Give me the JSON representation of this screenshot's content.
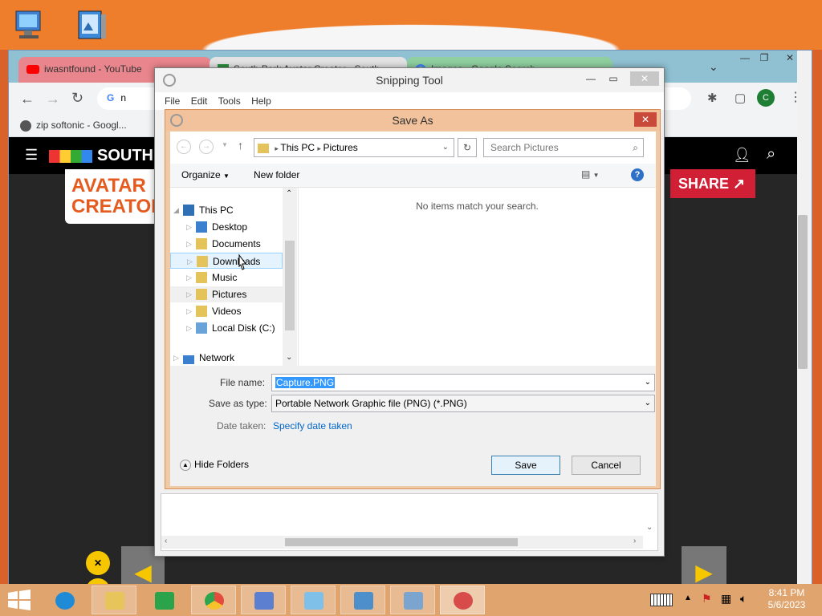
{
  "desktop": {
    "icons": [
      {
        "name": "computer-icon"
      },
      {
        "name": "picture-app-icon"
      }
    ]
  },
  "chrome": {
    "tabs": [
      {
        "label": "iwasntfound - YouTube"
      },
      {
        "label": "South Park Avatar Creator - South"
      },
      {
        "label": "Images - Google Search"
      }
    ],
    "address_text": "n",
    "bookmark": "zip softonic - Googl...",
    "profile_initial": "C",
    "page": {
      "logo_text": "SOUTH",
      "banner_line1": "AVATAR",
      "banner_line2": "CREATOR",
      "share_label": "SHARE"
    }
  },
  "snipping_tool": {
    "title": "Snipping Tool",
    "menu": [
      "File",
      "Edit",
      "Tools",
      "Help"
    ]
  },
  "save_as": {
    "title": "Save As",
    "path": [
      "This PC",
      "Pictures"
    ],
    "search_placeholder": "Search Pictures",
    "organize_label": "Organize",
    "new_folder_label": "New folder",
    "nav_tree": [
      {
        "label": "This PC",
        "level": 0
      },
      {
        "label": "Desktop",
        "level": 1
      },
      {
        "label": "Documents",
        "level": 1
      },
      {
        "label": "Downloads",
        "level": 1
      },
      {
        "label": "Music",
        "level": 1
      },
      {
        "label": "Pictures",
        "level": 1
      },
      {
        "label": "Videos",
        "level": 1
      },
      {
        "label": "Local Disk (C:)",
        "level": 1
      },
      {
        "label": "Network",
        "level": 0
      }
    ],
    "empty_message": "No items match your search.",
    "file_name_label": "File name:",
    "file_name_value": "Capture.PNG",
    "save_type_label": "Save as type:",
    "save_type_value": "Portable Network Graphic file (PNG) (*.PNG)",
    "date_taken_label": "Date taken:",
    "date_taken_link": "Specify date taken",
    "hide_folders_label": "Hide Folders",
    "save_button": "Save",
    "cancel_button": "Cancel"
  },
  "taskbar": {
    "apps": [
      {
        "name": "internet-explorer-icon",
        "color": "#1f8ad6"
      },
      {
        "name": "file-explorer-icon",
        "color": "#e7c55a"
      },
      {
        "name": "store-icon",
        "color": "#2aa34a"
      },
      {
        "name": "chrome-icon",
        "color": "#e44b3c"
      },
      {
        "name": "media-icon",
        "color": "#5d7fcf"
      },
      {
        "name": "notepad-icon",
        "color": "#7ec0e8"
      },
      {
        "name": "photos-icon",
        "color": "#4c8fca"
      },
      {
        "name": "window-icon",
        "color": "#7ba5cf"
      },
      {
        "name": "snipping-tool-icon",
        "color": "#d84b4b"
      }
    ],
    "time": "8:41 PM",
    "date": "5/6/2023"
  },
  "colors": {
    "taskbar": "#e0a56e",
    "dialog_frame": "#f0c9a6",
    "link": "#0066cc",
    "selection": "#3399ff"
  }
}
